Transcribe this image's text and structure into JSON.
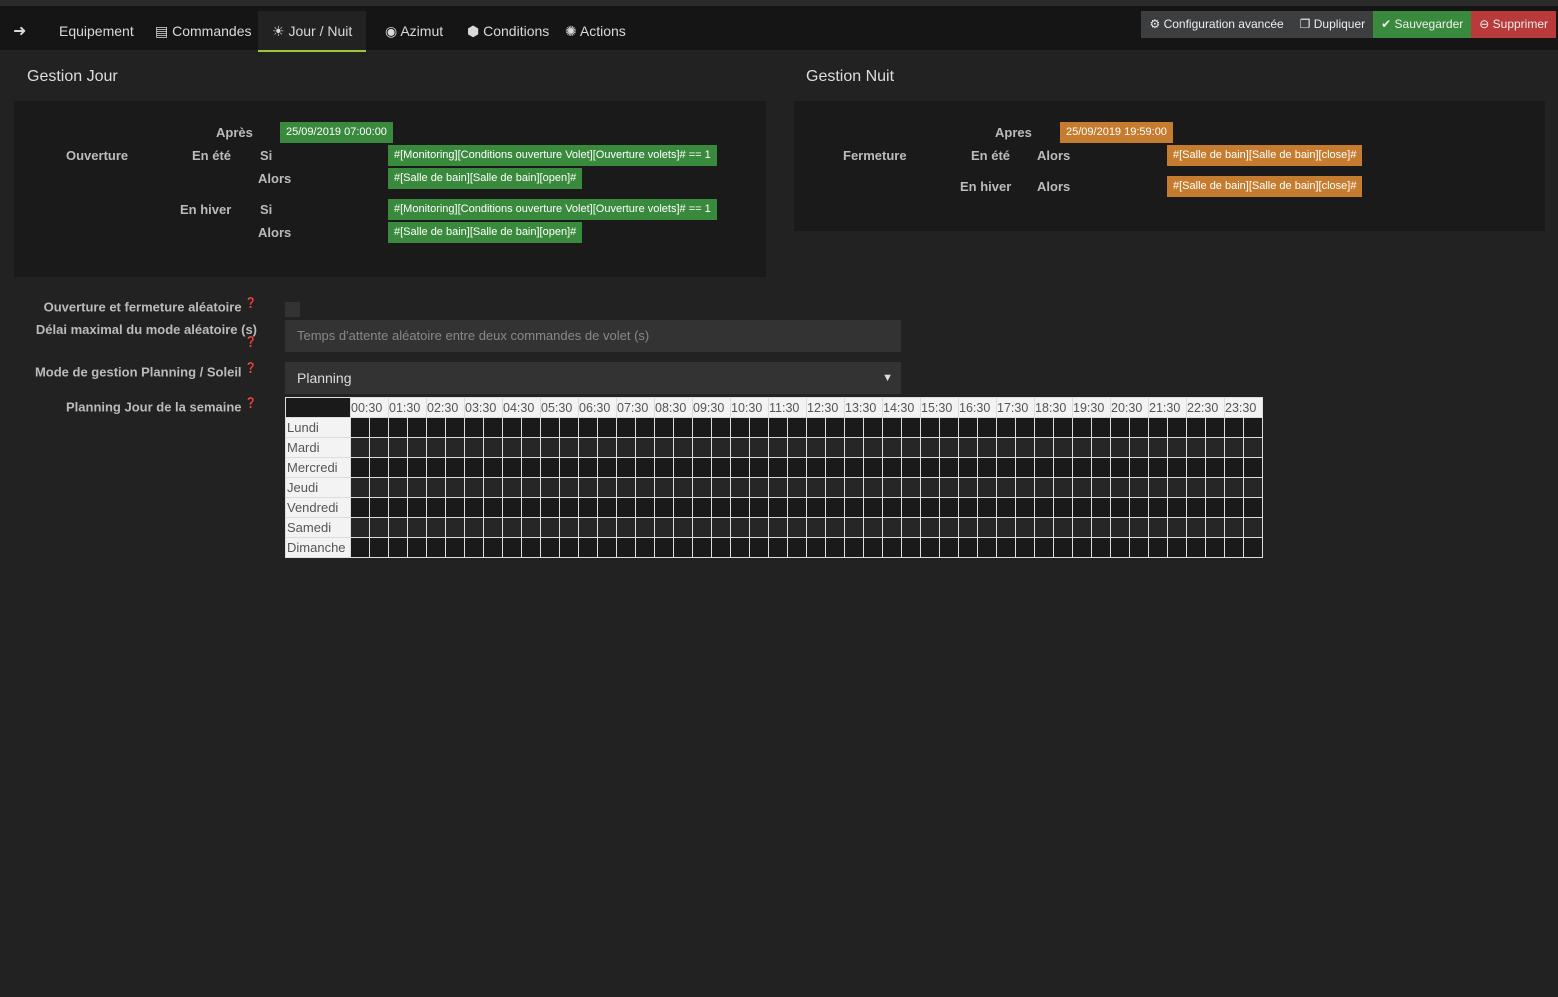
{
  "nav": {
    "back_icon": "arrow-circle-left-icon",
    "tabs": [
      {
        "label": "Equipement"
      },
      {
        "label": "Commandes",
        "icon": "list-icon"
      },
      {
        "label": "Jour / Nuit",
        "icon": "sun-icon"
      },
      {
        "label": "Azimut",
        "icon": "globe-icon"
      },
      {
        "label": "Conditions",
        "icon": "cube-icon"
      },
      {
        "label": "Actions",
        "icon": "spinner-icon"
      }
    ],
    "active_tab": "Jour / Nuit"
  },
  "toolbar": {
    "advanced": "Configuration avancée",
    "duplicate": "Dupliquer",
    "save": "Sauvegarder",
    "delete": "Supprimer"
  },
  "colors": {
    "green": "#3a8a3e",
    "orange": "#c67c2f",
    "red": "#b83a3a",
    "accent": "#9bc53d"
  },
  "jour": {
    "title": "Gestion Jour",
    "apres": "Après",
    "date": "25/09/2019 07:00:00",
    "ouverture": "Ouverture",
    "ete": "En été",
    "hiver": "En hiver",
    "si": "Si",
    "alors": "Alors",
    "ete_si": "#[Monitoring][Conditions ouverture Volet][Ouverture volets]# == 1",
    "ete_alors": "#[Salle de bain][Salle de bain][open]#",
    "hiver_si": "#[Monitoring][Conditions ouverture Volet][Ouverture volets]# == 1",
    "hiver_alors": "#[Salle de bain][Salle de bain][open]#"
  },
  "nuit": {
    "title": "Gestion Nuit",
    "apres": "Apres",
    "date": "25/09/2019 19:59:00",
    "fermeture": "Fermeture",
    "ete": "En été",
    "hiver": "En hiver",
    "alors": "Alors",
    "ete_alors": "#[Salle de bain][Salle de bain][close]#",
    "hiver_alors": "#[Salle de bain][Salle de bain][close]#"
  },
  "form": {
    "random_label": "Ouverture et fermeture aléatoire",
    "random_checked": false,
    "delay_label": "Délai maximal du mode aléatoire (s)",
    "delay_placeholder": "Temps d'attente aléatoire entre deux commandes de volet (s)",
    "mode_label": "Mode de gestion Planning / Soleil",
    "mode_value": "Planning",
    "planning_label": "Planning Jour de la semaine"
  },
  "planning": {
    "hours": [
      "00:30",
      "01:30",
      "02:30",
      "03:30",
      "04:30",
      "05:30",
      "06:30",
      "07:30",
      "08:30",
      "09:30",
      "10:30",
      "11:30",
      "12:30",
      "13:30",
      "14:30",
      "15:30",
      "16:30",
      "17:30",
      "18:30",
      "19:30",
      "20:30",
      "21:30",
      "22:30",
      "23:30"
    ],
    "days": [
      "Lundi",
      "Mardi",
      "Mercredi",
      "Jeudi",
      "Vendredi",
      "Samedi",
      "Dimanche"
    ]
  }
}
